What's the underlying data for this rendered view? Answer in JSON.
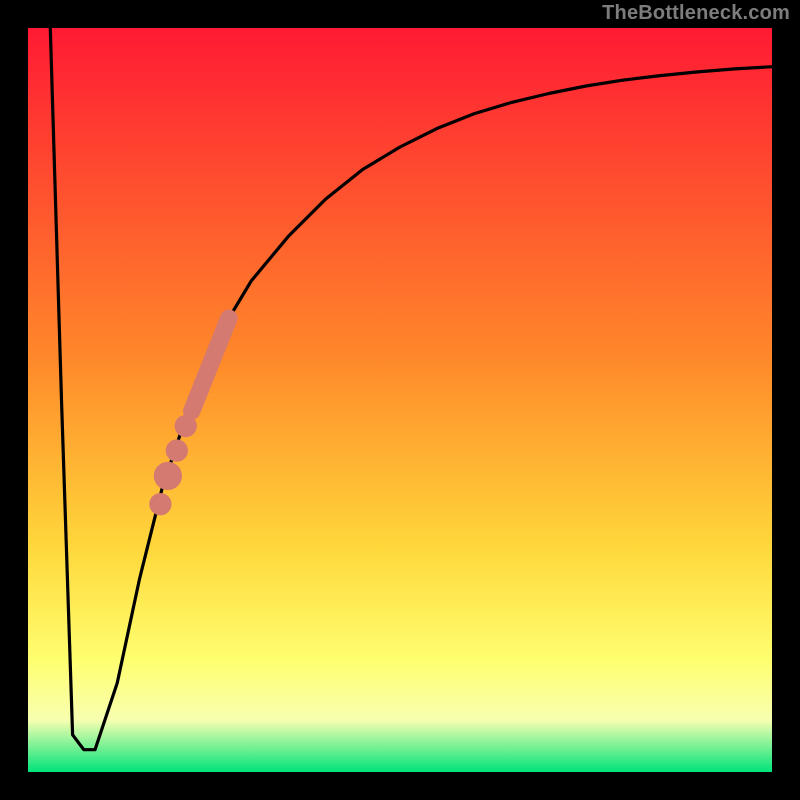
{
  "attribution": "TheBottleneck.com",
  "colors": {
    "frame": "#000000",
    "curve": "#000000",
    "markers": "#d47a70",
    "grad_top": "#ff1a33",
    "grad_mid1": "#ff8a2a",
    "grad_mid2": "#ffd83b",
    "grad_mid3": "#ffff70",
    "grad_mid4": "#f7ffb0",
    "grad_bottom": "#00e37a"
  },
  "chart_data": {
    "type": "line",
    "title": "",
    "xlabel": "",
    "ylabel": "",
    "xlim": [
      0,
      100
    ],
    "ylim": [
      0,
      100
    ],
    "grid": false,
    "series": [
      {
        "name": "curve",
        "x": [
          3,
          4.5,
          6,
          7.5,
          9,
          12,
          15,
          18,
          21,
          24,
          27,
          30,
          35,
          40,
          45,
          50,
          55,
          60,
          65,
          70,
          75,
          80,
          85,
          90,
          95,
          100
        ],
        "values": [
          100,
          50,
          5,
          3,
          3,
          12,
          26,
          38,
          47,
          55,
          61,
          66,
          72,
          77,
          81,
          84,
          86.5,
          88.5,
          90,
          91.2,
          92.2,
          93,
          93.6,
          94.1,
          94.5,
          94.8
        ]
      }
    ],
    "markers": {
      "kind": "scatter",
      "color": "#d47a70",
      "bar_segment": {
        "x0": 22,
        "y0": 48.5,
        "x1": 27,
        "y1": 61,
        "width": 2.6
      },
      "dots": [
        {
          "x": 21.2,
          "y": 46.5,
          "r": 1.5
        },
        {
          "x": 20.0,
          "y": 43.2,
          "r": 1.5
        },
        {
          "x": 18.8,
          "y": 39.8,
          "r": 1.9
        },
        {
          "x": 17.8,
          "y": 36.0,
          "r": 1.5
        }
      ]
    },
    "background_gradient": [
      {
        "stop": 0.0,
        "color": "#ff1a33"
      },
      {
        "stop": 0.45,
        "color": "#ff8a2a"
      },
      {
        "stop": 0.7,
        "color": "#ffd83b"
      },
      {
        "stop": 0.85,
        "color": "#ffff70"
      },
      {
        "stop": 0.93,
        "color": "#f7ffb0"
      },
      {
        "stop": 1.0,
        "color": "#00e37a"
      }
    ]
  }
}
